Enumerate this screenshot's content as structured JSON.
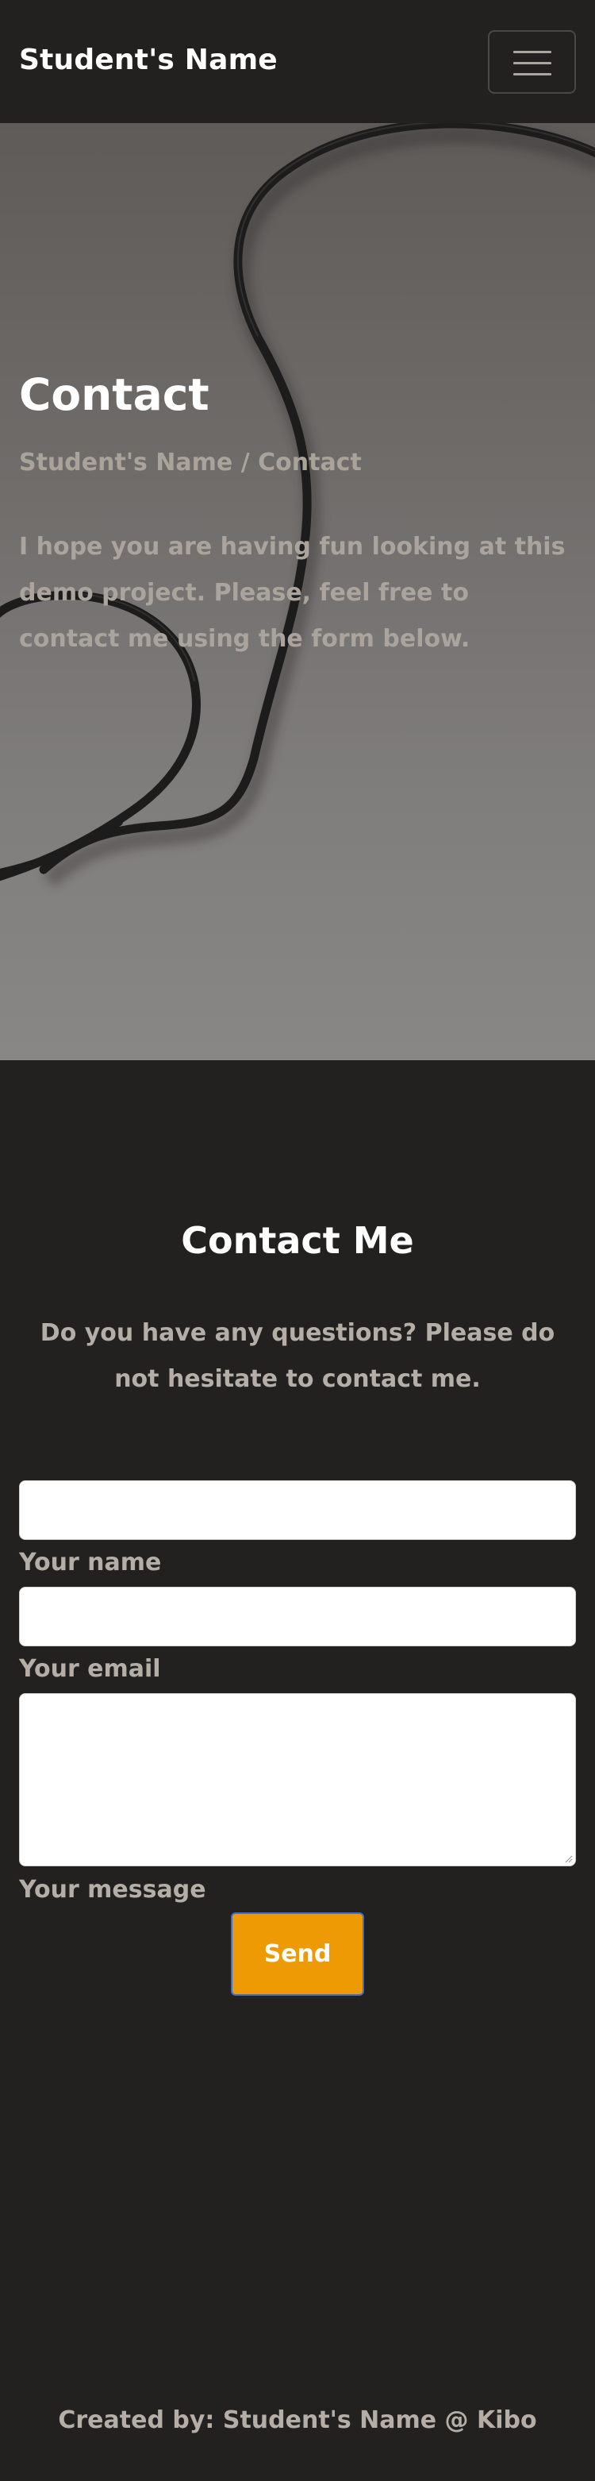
{
  "navbar": {
    "brand": "Student's Name",
    "toggle_icon": "hamburger-menu-icon"
  },
  "hero": {
    "title": "Contact",
    "breadcrumb": "Student's Name / Contact",
    "text": "I hope you are having fun looking at this demo project. Please, feel free to contact me using the form below."
  },
  "contact": {
    "title": "Contact Me",
    "subtitle": "Do you have any questions? Please do not hesitate to contact me.",
    "form": {
      "name_label": "Your name",
      "name_value": "",
      "email_label": "Your email",
      "email_value": "",
      "message_label": "Your message",
      "message_value": "",
      "send_label": "Send"
    }
  },
  "footer": {
    "text": "Created by: Student's Name @ Kibo"
  },
  "colors": {
    "background": "#232120",
    "accent": "#ee9a04",
    "muted_text": "#b4aea6",
    "button_border": "#3d6fd1"
  }
}
